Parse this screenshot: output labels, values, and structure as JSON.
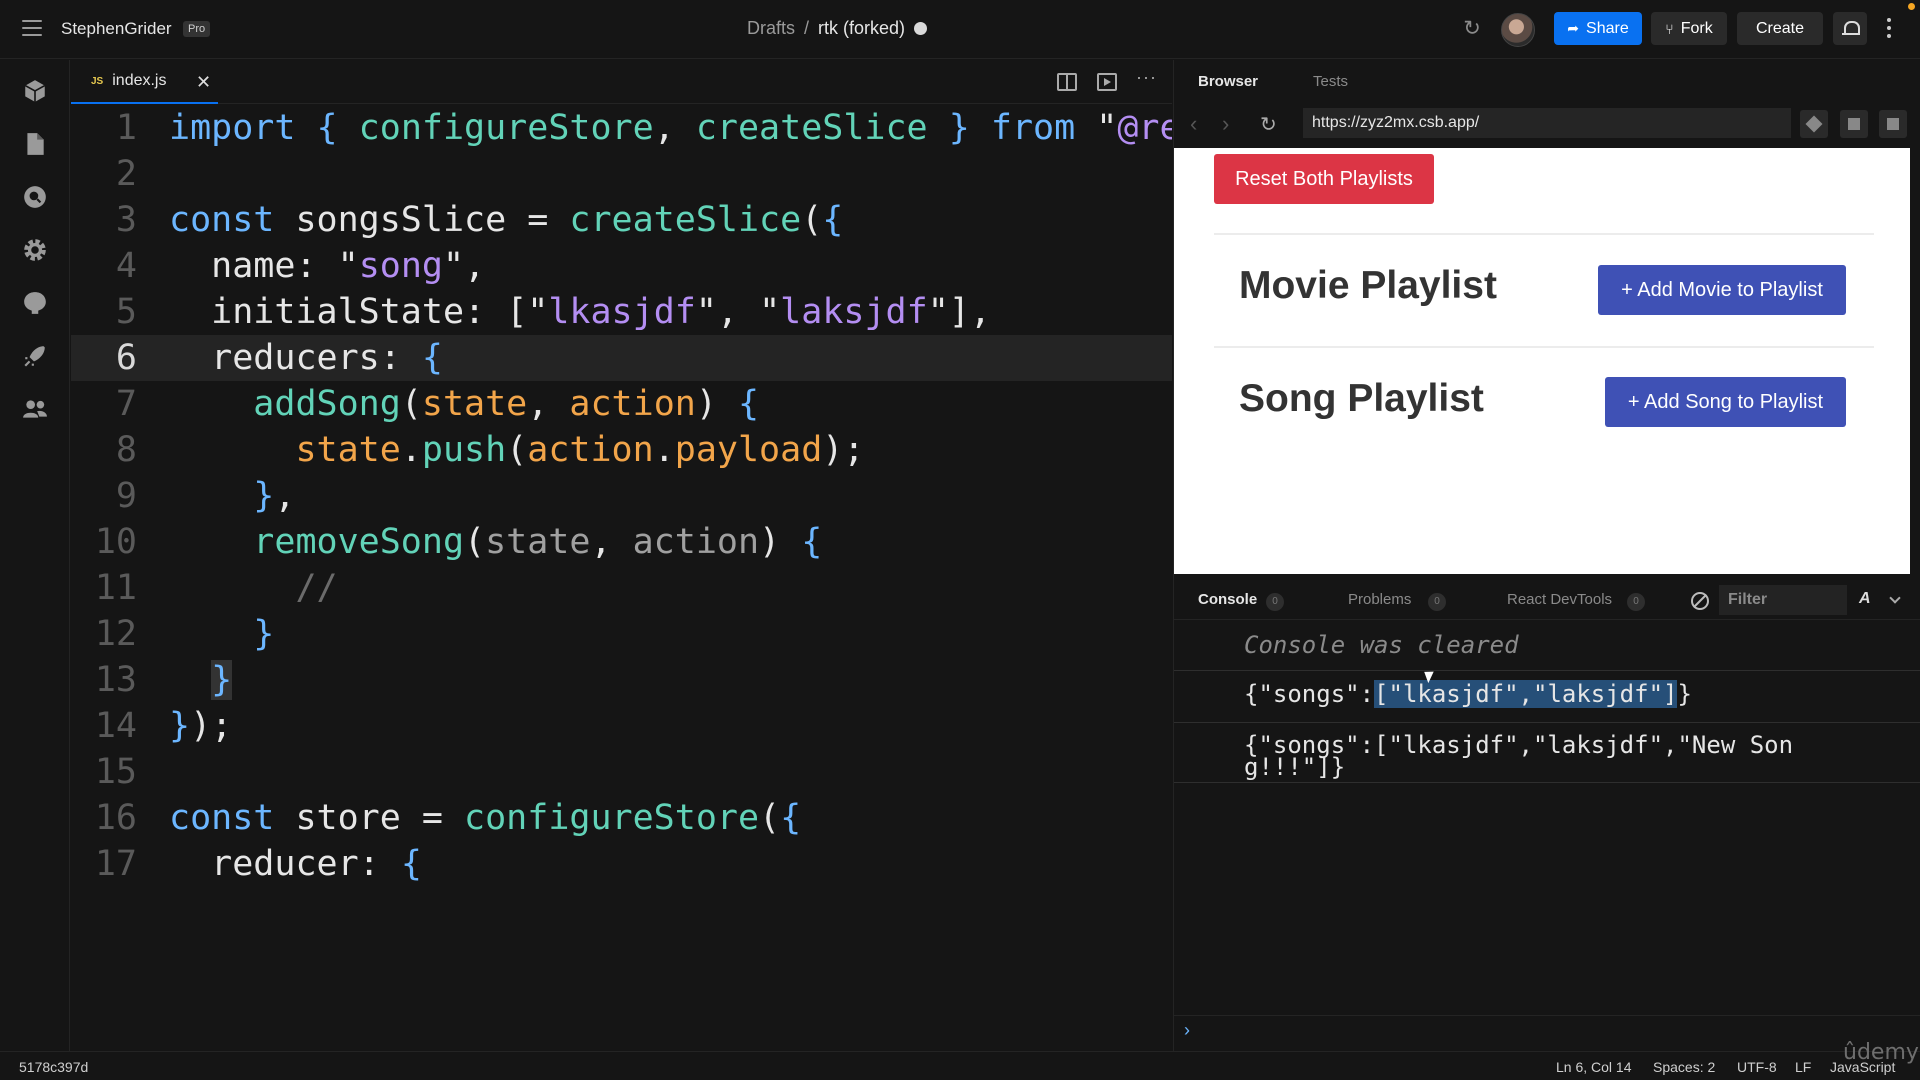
{
  "topbar": {
    "user": "StephenGrider",
    "badge": "Pro",
    "breadcrumb_parent": "Drafts",
    "breadcrumb_sep": "/",
    "project": "rtk (forked)",
    "share_label": "Share",
    "fork_label": "Fork",
    "create_label": "Create"
  },
  "sidebar": {
    "icons": [
      "cube-icon",
      "file-icon",
      "search-icon",
      "gear-icon",
      "github-icon",
      "rocket-icon",
      "users-icon"
    ]
  },
  "editor": {
    "tab_label": "index.js",
    "tab_lang_badge": "JS",
    "active_line": 6,
    "lines": [
      "import { configureStore, createSlice } from \"@re",
      "",
      "const songsSlice = createSlice({",
      "  name: \"song\",",
      "  initialState: [\"lkasjdf\", \"laksjdf\"],",
      "  reducers: {",
      "    addSong(state, action) {",
      "      state.push(action.payload);",
      "    },",
      "    removeSong(state, action) {",
      "      //",
      "    }",
      "  }",
      "});",
      "",
      "const store = configureStore({",
      "  reducer: {"
    ]
  },
  "preview": {
    "tabs": [
      "Browser",
      "Tests"
    ],
    "url": "https://zyz2mx.csb.app/",
    "reset_label": "Reset Both Playlists",
    "movie_title": "Movie Playlist",
    "movie_button": "+ Add Movie to Playlist",
    "song_title": "Song Playlist",
    "song_button": "+ Add Song to Playlist"
  },
  "console": {
    "tabs": [
      {
        "label": "Console",
        "count": "0"
      },
      {
        "label": "Problems",
        "count": "0"
      },
      {
        "label": "React DevTools",
        "count": "0"
      }
    ],
    "filter_placeholder": "Filter",
    "level": "A",
    "cleared": "Console was cleared",
    "msg1_prefix": "{\"songs\":",
    "msg1_selected": "[\"lkasjdf\",\"laksjdf\"]",
    "msg1_suffix": "}",
    "msg2_line1": "{\"songs\":[\"lkasjdf\",\"laksjdf\",\"New Son",
    "msg2_line2": "g!!!\"]}"
  },
  "statusbar": {
    "commit": "5178c397d",
    "position": "Ln 6, Col 14",
    "spaces": "Spaces: 2",
    "encoding": "UTF-8",
    "eol": "LF",
    "language": "JavaScript",
    "watermark": "ûdemy"
  },
  "colors": {
    "accent": "#0971f1",
    "reset_button": "#dc3545",
    "playlist_button": "#3f51b5"
  }
}
